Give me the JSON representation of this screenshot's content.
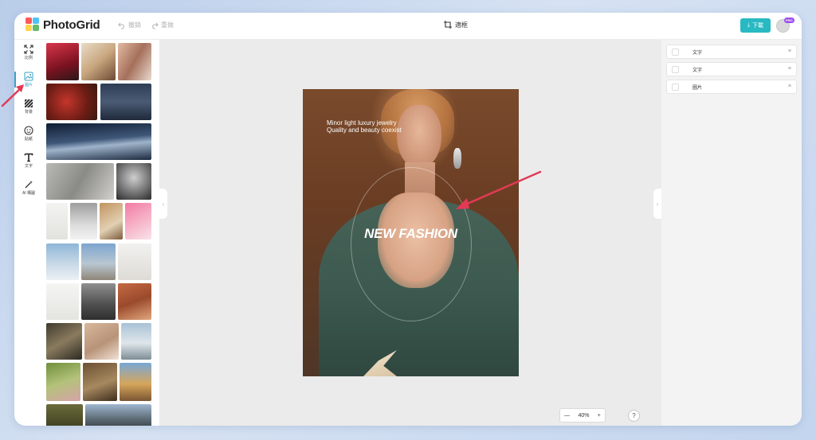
{
  "app": {
    "name": "PhotoGrid"
  },
  "header": {
    "undo_label": "撤銷",
    "redo_label": "重做",
    "crop_label": "適框",
    "download_label": "下載",
    "pro_badge": "PRO"
  },
  "rail": {
    "items": [
      {
        "label": "比例",
        "icon": "expand-icon"
      },
      {
        "label": "圖片",
        "icon": "image-icon"
      },
      {
        "label": "背景",
        "icon": "stripes-icon"
      },
      {
        "label": "貼紙",
        "icon": "sticker-icon"
      },
      {
        "label": "文字",
        "icon": "text-icon"
      },
      {
        "label": "AI 構圖",
        "icon": "magic-wand-icon"
      }
    ]
  },
  "artboard": {
    "tagline_1": "Minor light luxury jewelry",
    "tagline_2": "Quality and beauty coexist",
    "headline": "NEW FASHION"
  },
  "zoom": {
    "minus": "—",
    "value": "40%",
    "plus": "+"
  },
  "help": {
    "label": "?"
  },
  "layers": {
    "items": [
      {
        "label": "文字"
      },
      {
        "label": "文字"
      },
      {
        "label": "圖片"
      }
    ]
  },
  "colors": {
    "accent": "#29b9c2",
    "active_tool": "#3aa3c6",
    "annotation": "#e23a55"
  }
}
